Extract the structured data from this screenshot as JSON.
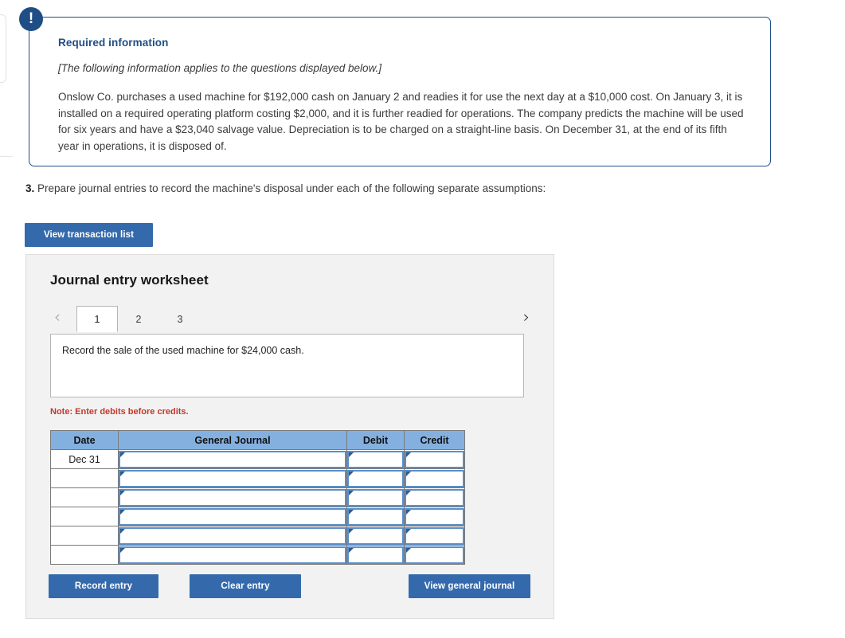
{
  "callout": {
    "icon": "exclamation-icon",
    "title": "Required information",
    "applies_note": "[The following information applies to the questions displayed below.]",
    "body": "Onslow Co. purchases a used machine for $192,000 cash on January 2 and readies it for use the next day at a $10,000 cost. On January 3, it is installed on a required operating platform costing $2,000, and it is further readied for operations. The company predicts the machine will be used for six years and have a $23,040 salvage value. Depreciation is to be charged on a straight-line basis. On December 31, at the end of its fifth year in operations, it is disposed of.",
    "border_color": "#1f4e86",
    "title_color": "#1f4e86"
  },
  "question": {
    "number": "3.",
    "text": " Prepare journal entries to record the machine's disposal under each of the following separate assumptions:"
  },
  "buttons": {
    "view_transaction_list": "View transaction list",
    "record_entry": "Record entry",
    "clear_entry": "Clear entry",
    "view_general_journal": "View general journal",
    "accent_color": "#346aac"
  },
  "worksheet": {
    "title": "Journal entry worksheet",
    "prev_arrow": "‹",
    "next_arrow": "›",
    "tabs": [
      {
        "label": "1",
        "active": true
      },
      {
        "label": "2",
        "active": false
      },
      {
        "label": "3",
        "active": false
      }
    ],
    "description": "Record the sale of the used machine for $24,000 cash.",
    "note": "Note: Enter debits before credits.",
    "note_color": "#c0392b"
  },
  "journal_table": {
    "headers": [
      "Date",
      "General Journal",
      "Debit",
      "Credit"
    ],
    "header_bg": "#84b0e0",
    "rows": [
      {
        "date": "Dec 31",
        "general_journal": "",
        "debit": "",
        "credit": ""
      },
      {
        "date": "",
        "general_journal": "",
        "debit": "",
        "credit": ""
      },
      {
        "date": "",
        "general_journal": "",
        "debit": "",
        "credit": ""
      },
      {
        "date": "",
        "general_journal": "",
        "debit": "",
        "credit": ""
      },
      {
        "date": "",
        "general_journal": "",
        "debit": "",
        "credit": ""
      },
      {
        "date": "",
        "general_journal": "",
        "debit": "",
        "credit": ""
      }
    ]
  }
}
